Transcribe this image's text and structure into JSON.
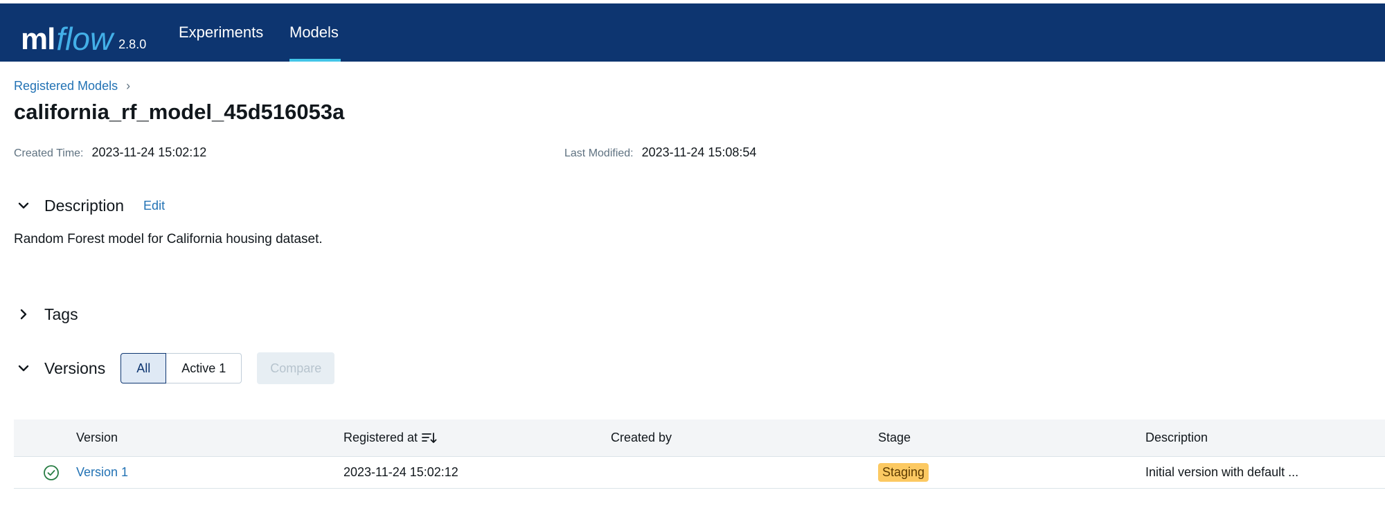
{
  "header": {
    "logo_ml": "ml",
    "logo_flow": "flow",
    "version": "2.8.0",
    "nav": [
      {
        "label": "Experiments",
        "active": false
      },
      {
        "label": "Models",
        "active": true
      }
    ]
  },
  "breadcrumb": {
    "label": "Registered Models",
    "separator": "›"
  },
  "model": {
    "name": "california_rf_model_45d516053a",
    "created_label": "Created Time:",
    "created_value": "2023-11-24 15:02:12",
    "modified_label": "Last Modified:",
    "modified_value": "2023-11-24 15:08:54"
  },
  "description_section": {
    "title": "Description",
    "edit_label": "Edit",
    "text": "Random Forest model for California housing dataset.",
    "expanded": true
  },
  "tags_section": {
    "title": "Tags",
    "expanded": false
  },
  "versions_section": {
    "title": "Versions",
    "expanded": true,
    "filter_all": "All",
    "filter_active": "Active 1",
    "compare_label": "Compare"
  },
  "table": {
    "columns": [
      "Version",
      "Registered at",
      "Created by",
      "Stage",
      "Description"
    ],
    "rows": [
      {
        "status": "ready",
        "version": "Version 1",
        "registered_at": "2023-11-24 15:02:12",
        "created_by": "",
        "stage": "Staging",
        "description": "Initial version with default ..."
      }
    ]
  },
  "colors": {
    "header_bg": "#0d3570",
    "accent": "#43c6e8",
    "link": "#2272b4",
    "staging_badge": "#fcc962",
    "status_ok": "#277c43"
  },
  "icons": [
    "chevron-down-icon",
    "chevron-right-icon",
    "sort-icon",
    "check-circle-icon"
  ]
}
